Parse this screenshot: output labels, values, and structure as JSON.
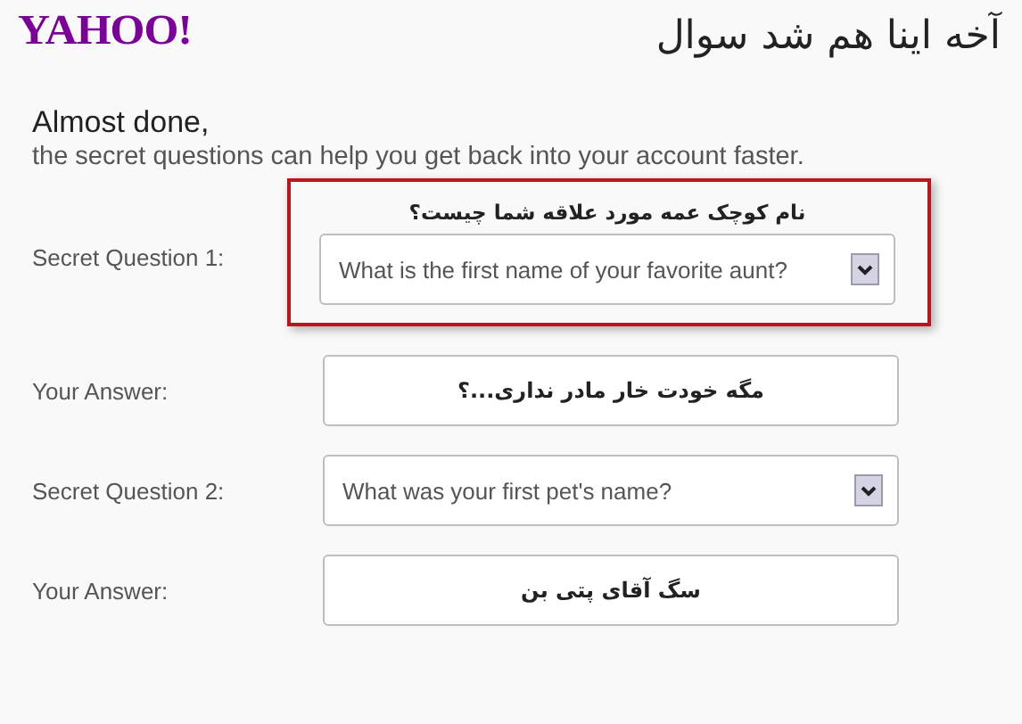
{
  "logo": "YAHOO!",
  "title": "آخه اینا هم شد سوال",
  "heading": "Almost done,",
  "subheading": "the secret questions can help you get back into your account faster.",
  "rows": [
    {
      "label": "Secret Question 1:",
      "kind": "select",
      "value": "What is the first name of your favorite aunt?",
      "highlighted": true,
      "annotation": "نام کوچک عمه مورد علاقه شما چیست؟"
    },
    {
      "label": "Your Answer:",
      "kind": "answer",
      "value": "مگه خودت خار مادر نداری...؟",
      "highlighted": false
    },
    {
      "label": "Secret Question 2:",
      "kind": "select",
      "value": "What was your first pet's name?",
      "highlighted": false
    },
    {
      "label": "Your Answer:",
      "kind": "answer",
      "value": "سگ آقای پتی بن",
      "highlighted": false
    }
  ]
}
